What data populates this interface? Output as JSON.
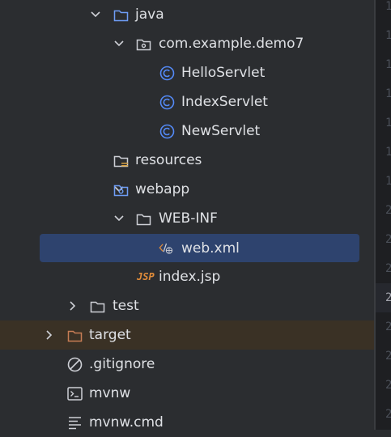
{
  "project_tree": {
    "items": [
      {
        "label": "java",
        "icon": "source-folder-icon"
      },
      {
        "label": "com.example.demo7",
        "icon": "package-icon"
      },
      {
        "label": "HelloServlet",
        "icon": "class-icon"
      },
      {
        "label": "IndexServlet",
        "icon": "class-icon"
      },
      {
        "label": "NewServlet",
        "icon": "class-icon"
      },
      {
        "label": "resources",
        "icon": "resources-folder-icon"
      },
      {
        "label": "webapp",
        "icon": "web-folder-icon"
      },
      {
        "label": "WEB-INF",
        "icon": "folder-icon"
      },
      {
        "label": "web.xml",
        "icon": "xml-file-icon",
        "selected": true
      },
      {
        "label": "index.jsp",
        "icon": "jsp-file-icon",
        "icon_text": "JSP"
      },
      {
        "label": "test",
        "icon": "folder-icon"
      },
      {
        "label": "target",
        "icon": "excluded-folder-icon"
      },
      {
        "label": ".gitignore",
        "icon": "ignore-file-icon"
      },
      {
        "label": "mvnw",
        "icon": "terminal-file-icon"
      },
      {
        "label": "mvnw.cmd",
        "icon": "text-file-icon"
      }
    ]
  },
  "editor_gutter": {
    "line_numbers": [
      "1",
      "1",
      "1",
      "1",
      "1",
      "1",
      "1",
      "2",
      "2",
      "2",
      "2",
      "2",
      "2",
      "2",
      "2"
    ],
    "current_line_index": 10
  },
  "colors": {
    "panel_bg": "#2b2d30",
    "selection": "#2e436e",
    "excluded_row": "#3a3125",
    "class_icon": "#548af7",
    "excluded_folder": "#c77d55",
    "jsp_icon": "#e08c3a"
  }
}
